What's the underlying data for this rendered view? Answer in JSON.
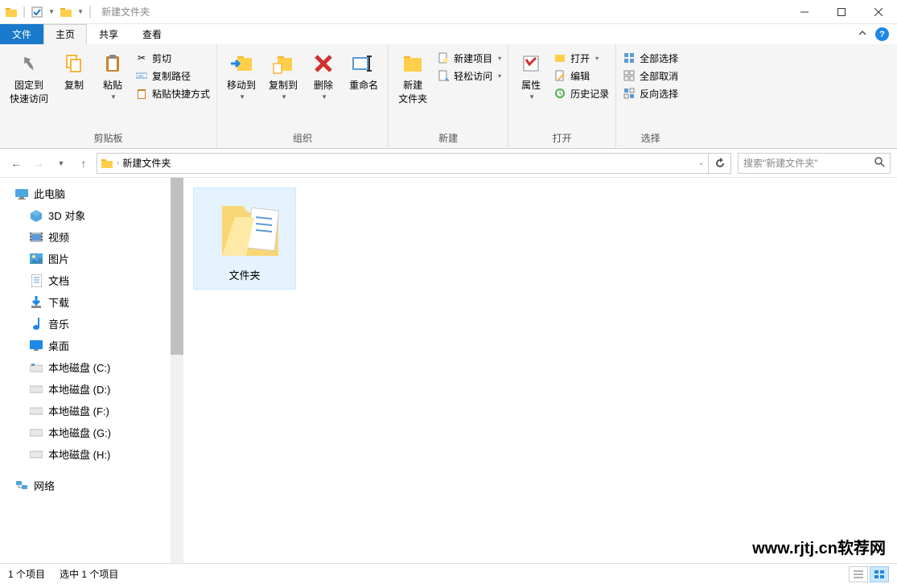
{
  "titlebar": {
    "title": "新建文件夹"
  },
  "ribbon_tabs": {
    "file": "文件",
    "home": "主页",
    "share": "共享",
    "view": "查看"
  },
  "ribbon": {
    "clipboard": {
      "label": "剪贴板",
      "pin": "固定到\n快速访问",
      "copy": "复制",
      "paste": "粘贴",
      "cut": "剪切",
      "copy_path": "复制路径",
      "paste_shortcut": "粘贴快捷方式"
    },
    "organize": {
      "label": "组织",
      "move_to": "移动到",
      "copy_to": "复制到",
      "delete": "删除",
      "rename": "重命名"
    },
    "new": {
      "label": "新建",
      "new_folder": "新建\n文件夹",
      "new_item": "新建项目",
      "easy_access": "轻松访问"
    },
    "open": {
      "label": "打开",
      "properties": "属性",
      "open": "打开",
      "edit": "编辑",
      "history": "历史记录"
    },
    "select": {
      "label": "选择",
      "select_all": "全部选择",
      "select_none": "全部取消",
      "invert": "反向选择"
    }
  },
  "address": {
    "current": "新建文件夹"
  },
  "search": {
    "placeholder": "搜索\"新建文件夹\""
  },
  "sidebar": {
    "this_pc": "此电脑",
    "items": [
      {
        "label": "3D 对象"
      },
      {
        "label": "视频"
      },
      {
        "label": "图片"
      },
      {
        "label": "文档"
      },
      {
        "label": "下载"
      },
      {
        "label": "音乐"
      },
      {
        "label": "桌面"
      },
      {
        "label": "本地磁盘 (C:)"
      },
      {
        "label": "本地磁盘 (D:)"
      },
      {
        "label": "本地磁盘 (F:)"
      },
      {
        "label": "本地磁盘 (G:)"
      },
      {
        "label": "本地磁盘 (H:)"
      }
    ],
    "network": "网络"
  },
  "content": {
    "folder": "文件夹"
  },
  "statusbar": {
    "item_count": "1 个项目",
    "selected": "选中 1 个项目"
  },
  "watermark": "www.rjtj.cn软荐网"
}
